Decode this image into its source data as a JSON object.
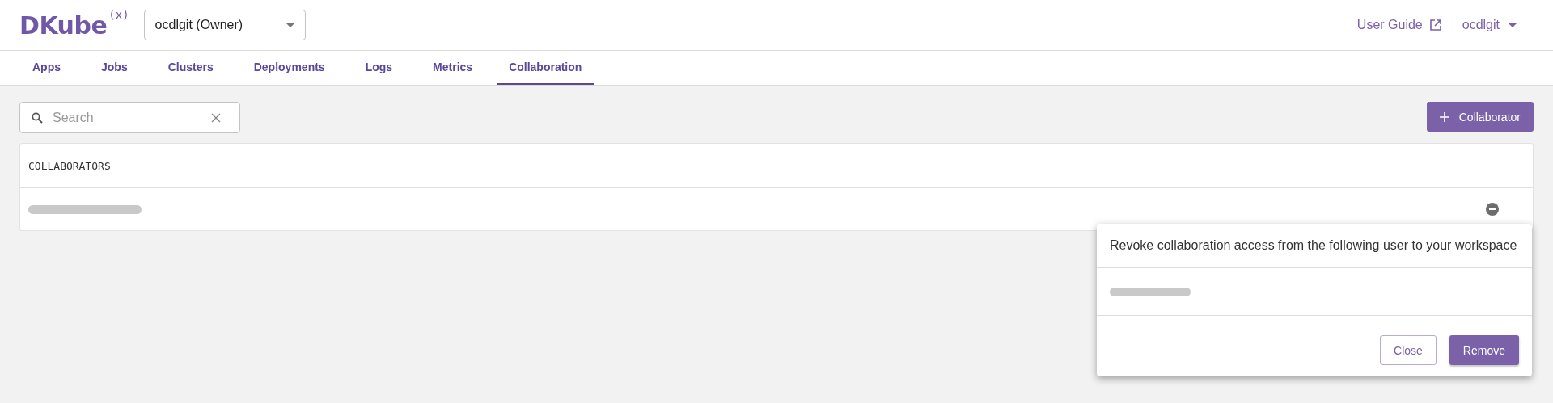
{
  "header": {
    "logo": "DKube",
    "logo_mark": "(x)",
    "workspace_select": {
      "value": "ocdlgit (Owner)"
    },
    "user_guide": "User Guide",
    "user_menu": "ocdlgit"
  },
  "tabs": [
    {
      "label": "Apps",
      "selected": false
    },
    {
      "label": "Jobs",
      "selected": false
    },
    {
      "label": "Clusters",
      "selected": false
    },
    {
      "label": "Deployments",
      "selected": false
    },
    {
      "label": "Logs",
      "selected": false
    },
    {
      "label": "Metrics",
      "selected": false
    },
    {
      "label": "Collaboration",
      "selected": true
    }
  ],
  "search": {
    "placeholder": "Search"
  },
  "add_button": "Collaborator",
  "table": {
    "columns": [
      "COLLABORATORS"
    ],
    "rows": [
      {
        "name_redacted": true
      }
    ]
  },
  "popover": {
    "message": "Revoke collaboration access from the following user to your workspace",
    "user_redacted": true,
    "buttons": [
      {
        "label": "Close",
        "kind": "outlined"
      },
      {
        "label": "Remove",
        "kind": "filled"
      }
    ]
  }
}
